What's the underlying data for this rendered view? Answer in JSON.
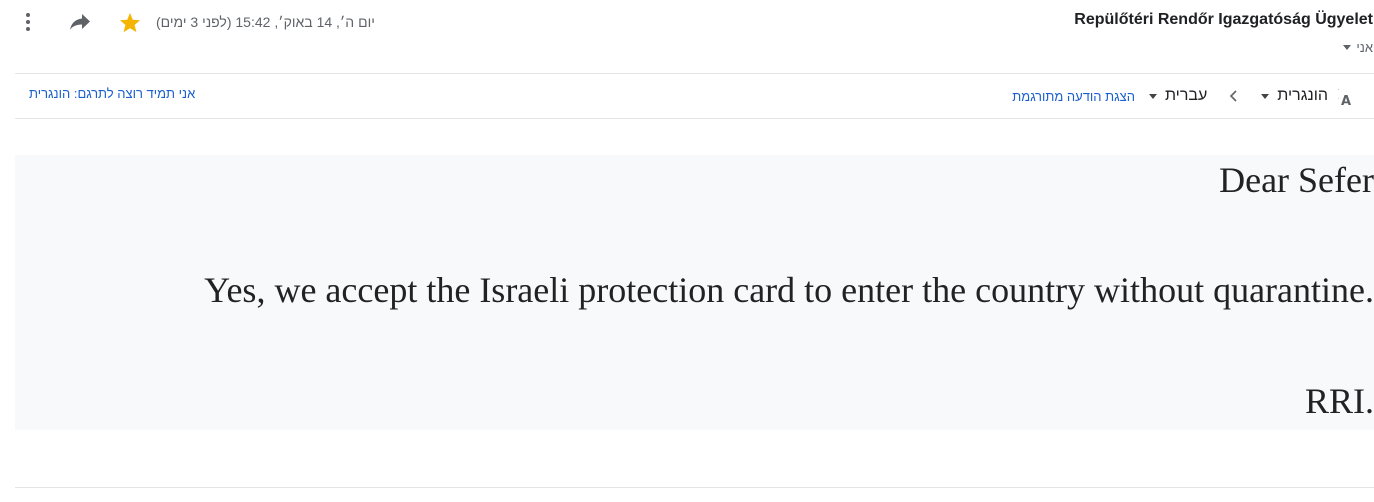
{
  "header": {
    "sender": "Repülőtéri Rendőr Igazgatóság Ügyelet",
    "recipient": "אני",
    "date": "יום ה׳, 14 באוק׳, 15:42 (לפני 3 ימים)",
    "starred": true,
    "colors": {
      "star": "#f4b400",
      "icon": "#5f6368"
    }
  },
  "translate_bar": {
    "source_language": "הונגרית",
    "target_language": "עברית",
    "show_translated_label": "הצגת הודעה מתורגמת",
    "always_translate_label": "אני תמיד רוצה לתרגם: הונגרית",
    "link_color": "#1a5fcf"
  },
  "message": {
    "lines": [
      "Dear Sefer",
      ".Yes, we accept the Israeli protection card to enter the country without quarantine",
      ".RRI"
    ]
  }
}
